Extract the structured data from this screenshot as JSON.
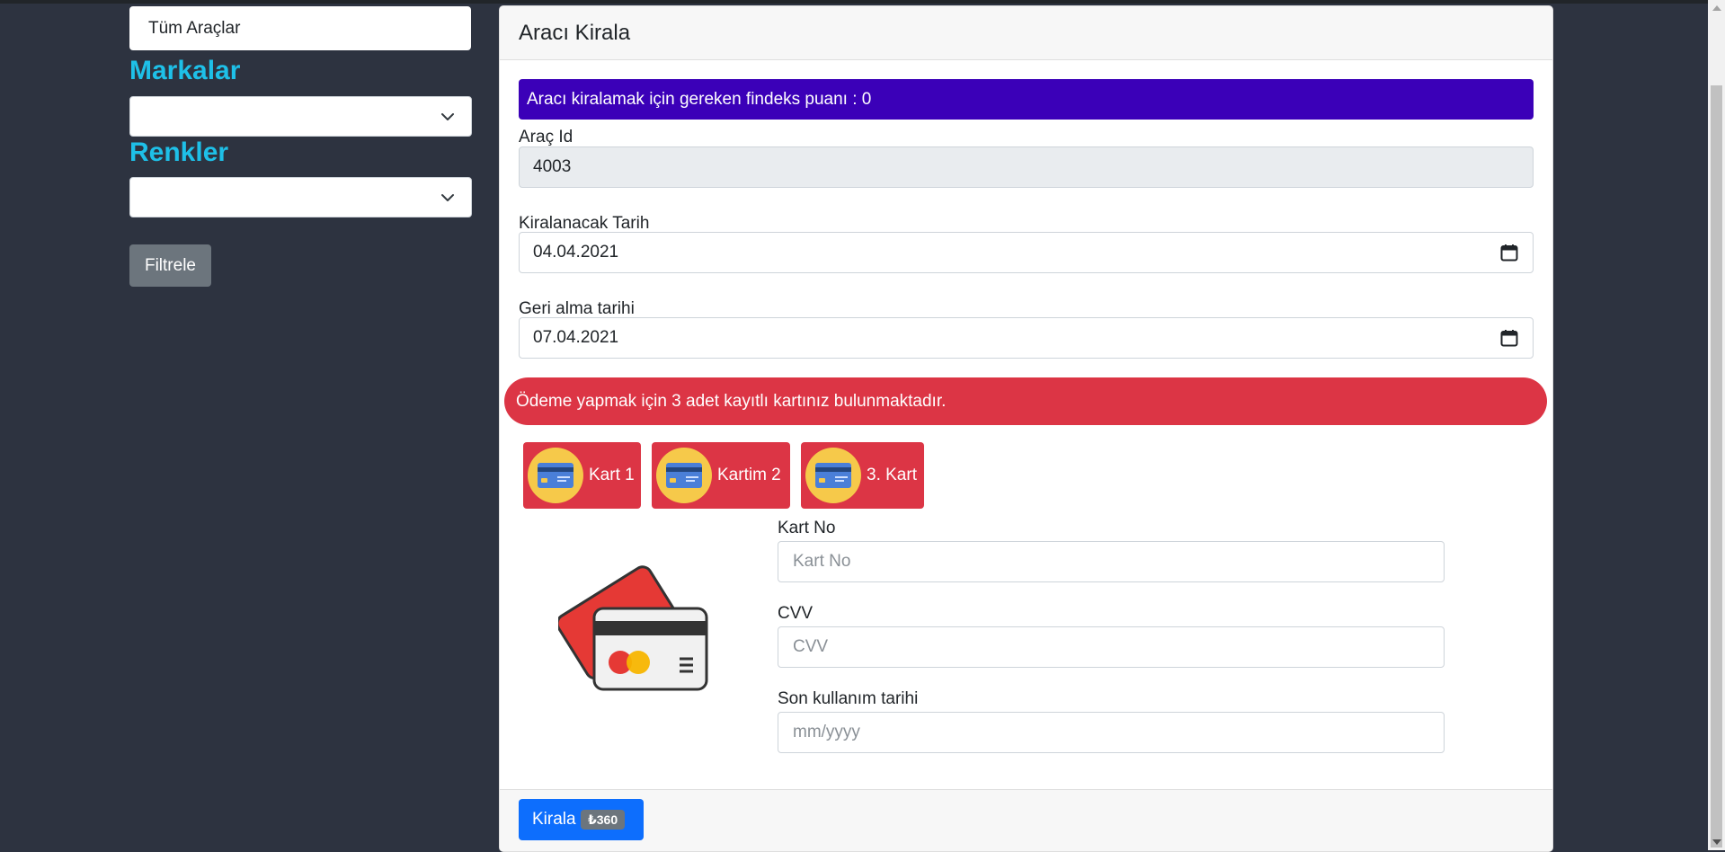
{
  "sidebar": {
    "all_cars": "Tüm Araçlar",
    "brands_title": "Markalar",
    "brands_value": "",
    "colors_title": "Renkler",
    "colors_value": "",
    "filter_button": "Filtrele"
  },
  "rent": {
    "title": "Aracı Kirala",
    "findeks_info": "Aracı kiralamak için gereken findeks puanı : 0",
    "car_id_label": "Araç Id",
    "car_id_value": "4003",
    "rent_date_label": "Kiralanacak Tarih",
    "rent_date_value": "04.04.2021",
    "return_date_label": "Geri alma tarihi",
    "return_date_value": "07.04.2021",
    "saved_cards_alert": "Ödeme yapmak için 3 adet kayıtlı kartınız bulunmaktadır.",
    "saved_cards": [
      {
        "label": "Kart 1"
      },
      {
        "label": "Kartim 2"
      },
      {
        "label": "3. Kart"
      }
    ],
    "card_no_label": "Kart No",
    "card_no_placeholder": "Kart No",
    "cvv_label": "CVV",
    "cvv_placeholder": "CVV",
    "expiry_label": "Son kullanım tarihi",
    "expiry_placeholder": "mm/yyyy",
    "rent_button": "Kirala",
    "price_badge": "₺360"
  },
  "colors": {
    "accent_cyan": "#1ec0e8",
    "info_purple": "#3b00b8",
    "danger": "#dc3545",
    "primary": "#0d6efd",
    "secondary": "#6c757d",
    "background": "#2d3340"
  },
  "icons": [
    "chevron-down-icon",
    "calendar-icon",
    "credit-card-icon",
    "credit-cards-illustration"
  ]
}
